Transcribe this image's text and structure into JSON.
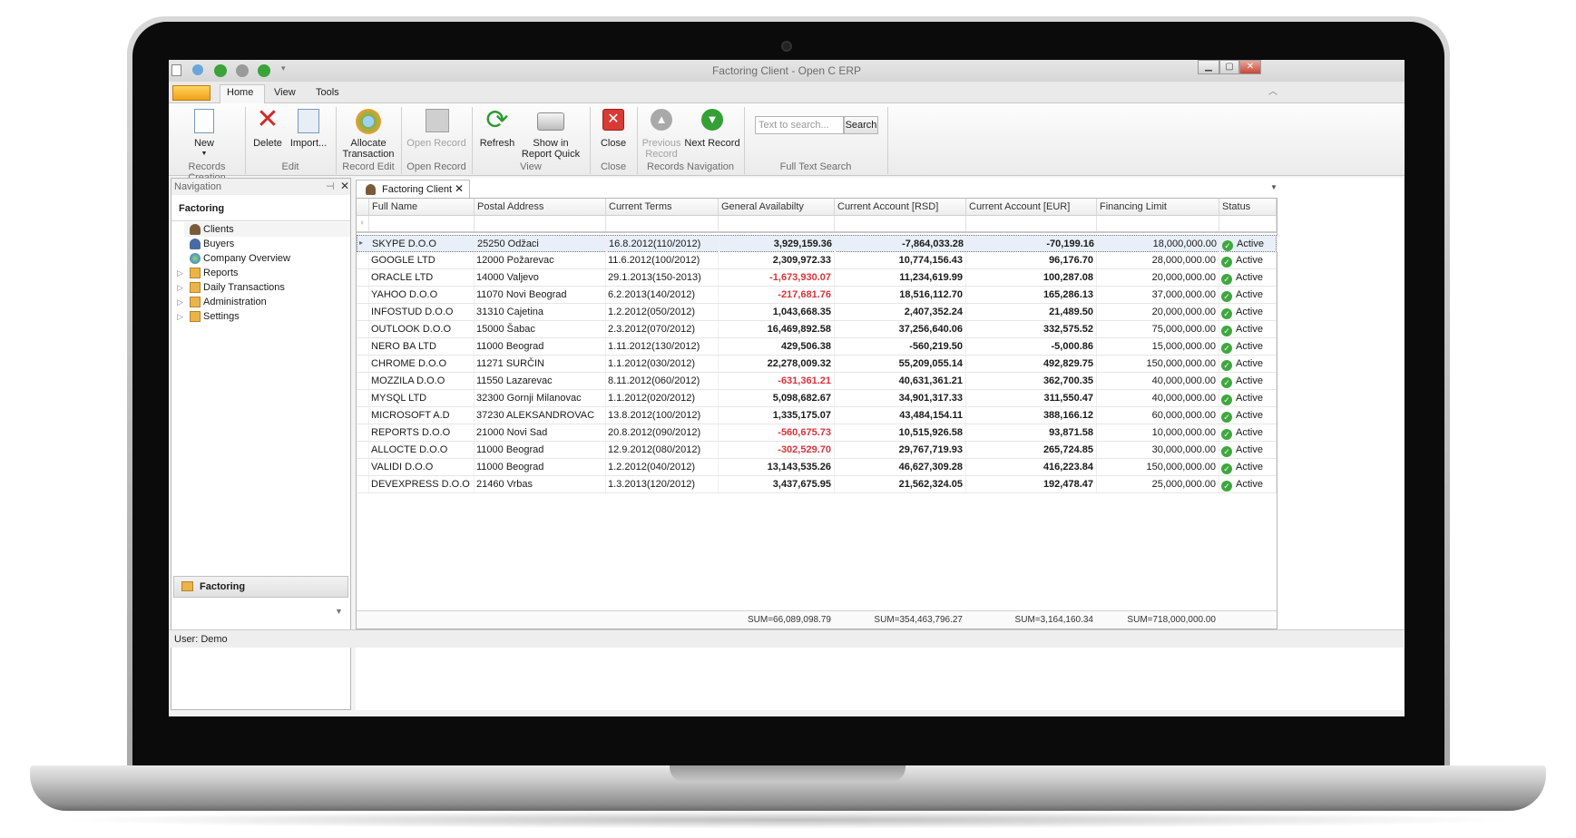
{
  "window": {
    "title": "Factoring Client - Open C ERP"
  },
  "ribbon_tabs": [
    "Home",
    "View",
    "Tools"
  ],
  "ribbon": {
    "buttons": {
      "new": "New",
      "delete": "Delete",
      "import": "Import...",
      "allocate_1": "Allocate",
      "allocate_2": "Transaction",
      "open_record": "Open Record",
      "refresh": "Refresh",
      "show_report_1": "Show in",
      "show_report_2": "Report Quick",
      "close": "Close",
      "prev_1": "Previous",
      "prev_2": "Record",
      "next_record": "Next Record"
    },
    "groups": {
      "records_creation": "Records Creation",
      "edit": "Edit",
      "record_edit": "Record Edit",
      "open_record": "Open Record",
      "view": "View",
      "close": "Close",
      "records_navigation": "Records Navigation",
      "full_text_search": "Full Text Search"
    },
    "search": {
      "placeholder": "Text to search...",
      "button": "Search"
    }
  },
  "navigation": {
    "header": "Navigation",
    "title": "Factoring",
    "items": [
      {
        "label": "Clients",
        "icon": "user-icon"
      },
      {
        "label": "Buyers",
        "icon": "user-icon"
      },
      {
        "label": "Company Overview",
        "icon": "globe-icon"
      },
      {
        "label": "Reports",
        "icon": "folder-icon"
      },
      {
        "label": "Daily Transactions",
        "icon": "folder-icon"
      },
      {
        "label": "Administration",
        "icon": "folder-icon"
      },
      {
        "label": "Settings",
        "icon": "folder-icon"
      }
    ],
    "group": "Factoring"
  },
  "document_tab": {
    "label": "Factoring Client"
  },
  "grid": {
    "columns": [
      "Full Name",
      "Postal Address",
      "Current Terms",
      "General Availabilty",
      "Current Account [RSD]",
      "Current Account [EUR]",
      "Financing Limit",
      "Status"
    ],
    "rows": [
      [
        "SKYPE D.O.O",
        "25250 Odžaci",
        "16.8.2012(110/2012)",
        "3,929,159.36",
        "-7,864,033.28",
        "-70,199.16",
        "18,000,000.00",
        "Active"
      ],
      [
        "GOOGLE LTD",
        "12000 Požarevac",
        "11.6.2012(100/2012)",
        "2,309,972.33",
        "10,774,156.43",
        "96,176.70",
        "28,000,000.00",
        "Active"
      ],
      [
        "ORACLE LTD",
        "14000 Valjevo",
        "29.1.2013(150-2013)",
        "-1,673,930.07",
        "11,234,619.99",
        "100,287.08",
        "20,000,000.00",
        "Active"
      ],
      [
        "YAHOO D.O.O",
        "11070 Novi Beograd",
        "6.2.2013(140/2012)",
        "-217,681.76",
        "18,516,112.70",
        "165,286.13",
        "37,000,000.00",
        "Active"
      ],
      [
        "INFOSTUD D.O.O",
        "31310 Cajetina",
        "1.2.2012(050/2012)",
        "1,043,668.35",
        "2,407,352.24",
        "21,489.50",
        "20,000,000.00",
        "Active"
      ],
      [
        "OUTLOOK D.O.O",
        "15000 Šabac",
        "2.3.2012(070/2012)",
        "16,469,892.58",
        "37,256,640.06",
        "332,575.52",
        "75,000,000.00",
        "Active"
      ],
      [
        "NERO BA LTD",
        "11000 Beograd",
        "1.11.2012(130/2012)",
        "429,506.38",
        "-560,219.50",
        "-5,000.86",
        "15,000,000.00",
        "Active"
      ],
      [
        "CHROME D.O.O",
        "11271 SURČIN",
        "1.1.2012(030/2012)",
        "22,278,009.32",
        "55,209,055.14",
        "492,829.75",
        "150,000,000.00",
        "Active"
      ],
      [
        "MOZZILA D.O.O",
        "11550 Lazarevac",
        "8.11.2012(060/2012)",
        "-631,361.21",
        "40,631,361.21",
        "362,700.35",
        "40,000,000.00",
        "Active"
      ],
      [
        "MYSQL LTD",
        "32300 Gornji Milanovac",
        "1.1.2012(020/2012)",
        "5,098,682.67",
        "34,901,317.33",
        "311,550.47",
        "40,000,000.00",
        "Active"
      ],
      [
        "MICROSOFT A.D",
        "37230 ALEKSANDROVAC",
        "13.8.2012(100/2012)",
        "1,335,175.07",
        "43,484,154.11",
        "388,166.12",
        "60,000,000.00",
        "Active"
      ],
      [
        "REPORTS D.O.O",
        "21000 Novi Sad",
        "20.8.2012(090/2012)",
        "-560,675.73",
        "10,515,926.58",
        "93,871.58",
        "10,000,000.00",
        "Active"
      ],
      [
        "ALLOCTE D.O.O",
        "11000 Beograd",
        "12.9.2012(080/2012)",
        "-302,529.70",
        "29,767,719.93",
        "265,724.85",
        "30,000,000.00",
        "Active"
      ],
      [
        "VALIDI D.O.O",
        "11000 Beograd",
        "1.2.2012(040/2012)",
        "13,143,535.26",
        "46,627,309.28",
        "416,223.84",
        "150,000,000.00",
        "Active"
      ],
      [
        "DEVEXPRESS D.O.O",
        "21460 Vrbas",
        "1.3.2013(120/2012)",
        "3,437,675.95",
        "21,562,324.05",
        "192,478.47",
        "25,000,000.00",
        "Active"
      ]
    ],
    "sums": [
      "SUM=66,089,098.79",
      "SUM=354,463,796.27",
      "SUM=3,164,160.34",
      "SUM=718,000,000.00"
    ]
  },
  "status_bar": {
    "user": "User: Demo"
  },
  "colors": {
    "negative": "#d8343b",
    "status_ok": "#3ea83e",
    "app_menu": "#f0a21a"
  }
}
